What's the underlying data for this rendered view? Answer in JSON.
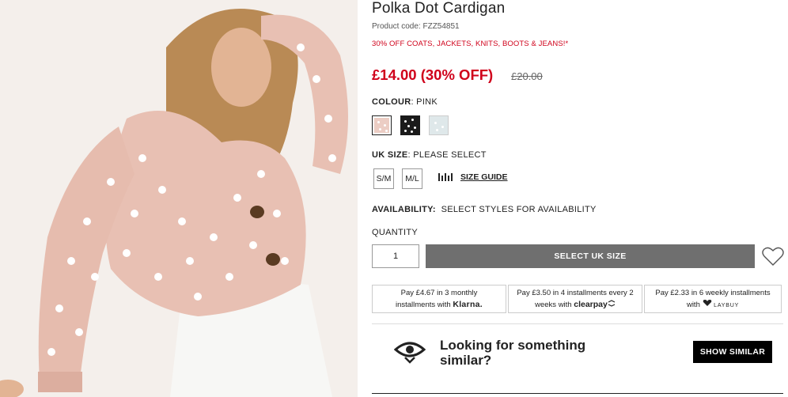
{
  "product": {
    "title": "Polka Dot Cardigan",
    "code": "Product code: FZZ54851",
    "promo": "30% OFF COATS, JACKETS, KNITS, BOOTS & JEANS!*",
    "price": "£14.00 (30% OFF)",
    "was_price": "£20.00"
  },
  "colour": {
    "label": "COLOUR",
    "value": ": PINK",
    "swatches": [
      {
        "name": "pink",
        "color": "#eccdc4"
      },
      {
        "name": "black",
        "color": "#1a1a1a"
      },
      {
        "name": "mint",
        "color": "#dfe8ea"
      }
    ]
  },
  "size": {
    "label": "UK SIZE",
    "value": ": PLEASE SELECT",
    "options": [
      "S/M",
      "M/L"
    ],
    "guide": "SIZE GUIDE"
  },
  "availability": {
    "label": "AVAILABILITY:",
    "value": "SELECT STYLES FOR AVAILABILITY"
  },
  "quantity": {
    "label": "QUANTITY",
    "value": "1"
  },
  "add_button": "SELECT UK SIZE",
  "payments": [
    {
      "line1": "Pay £4.67 in 3 monthly",
      "line2": "installments with",
      "brand": "Klarna."
    },
    {
      "line1": "Pay £3.50 in 4 installments every 2",
      "line2": "weeks with",
      "brand": "clearpay"
    },
    {
      "line1": "Pay £2.33 in 6 weekly installments",
      "line2": "with",
      "brand": "LAYBUY"
    }
  ],
  "similar": {
    "text": "Looking for something similar?",
    "button": "SHOW SIMILAR"
  },
  "colors": {
    "sale_red": "#d0021b",
    "button_grey": "#6f6f6f"
  }
}
